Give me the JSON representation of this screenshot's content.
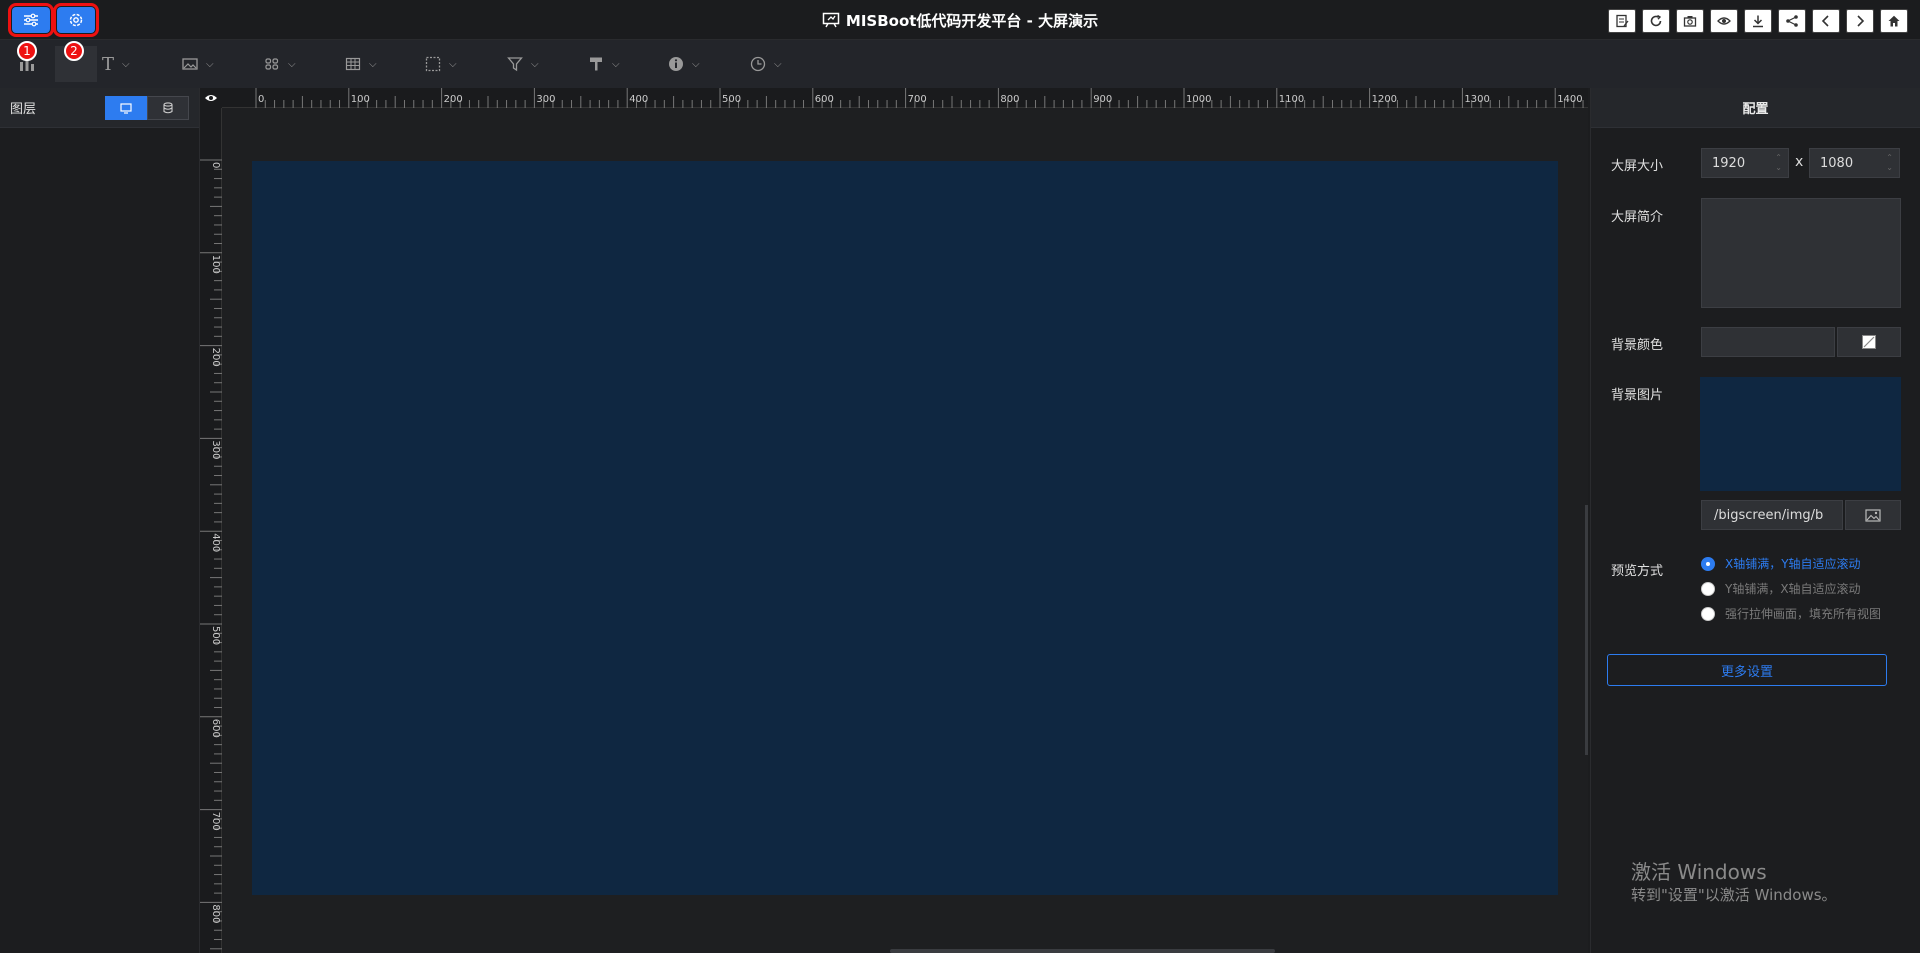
{
  "header": {
    "title": "MISBoot低代码开发平台 - 大屏演示",
    "annotations": [
      "1",
      "2"
    ],
    "tools": [
      "edit-icon",
      "refresh-icon",
      "camera-icon",
      "eye-icon",
      "download-icon",
      "share-icon",
      "prev-icon",
      "next-icon",
      "home-icon"
    ]
  },
  "toolbar": {
    "items": [
      "chart-icon",
      "text-icon",
      "image-icon",
      "component-icon",
      "table-icon",
      "border-icon",
      "filter-icon",
      "decoration-icon",
      "info-icon",
      "time-icon"
    ]
  },
  "left_panel": {
    "title": "图层"
  },
  "rulers": {
    "h_labels": [
      "0",
      "100",
      "200",
      "300",
      "400",
      "500",
      "600",
      "700",
      "800",
      "900",
      "1000",
      "1100",
      "1200",
      "1300",
      "1400"
    ],
    "v_labels": [
      "0",
      "100",
      "200",
      "300",
      "400",
      "500",
      "600",
      "700",
      "800"
    ]
  },
  "config": {
    "title": "配置",
    "size_label": "大屏大小",
    "width": "1920",
    "x": "x",
    "height": "1080",
    "intro_label": "大屏简介",
    "bgcolor_label": "背景颜色",
    "bgimage_label": "背景图片",
    "bgimage_path": "/bigscreen/img/b",
    "preview_label": "预览方式",
    "preview_options": [
      "X轴铺满，Y轴自适应滚动",
      "Y轴铺满，X轴自适应滚动",
      "强行拉伸画面，填充所有视图"
    ],
    "more_button": "更多设置"
  },
  "watermark": {
    "line1": "激活 Windows",
    "line2": "转到\"设置\"以激活 Windows。"
  },
  "colors": {
    "accent": "#2d7cf0",
    "screen": "#0f2741",
    "highlight": "#e11111"
  }
}
